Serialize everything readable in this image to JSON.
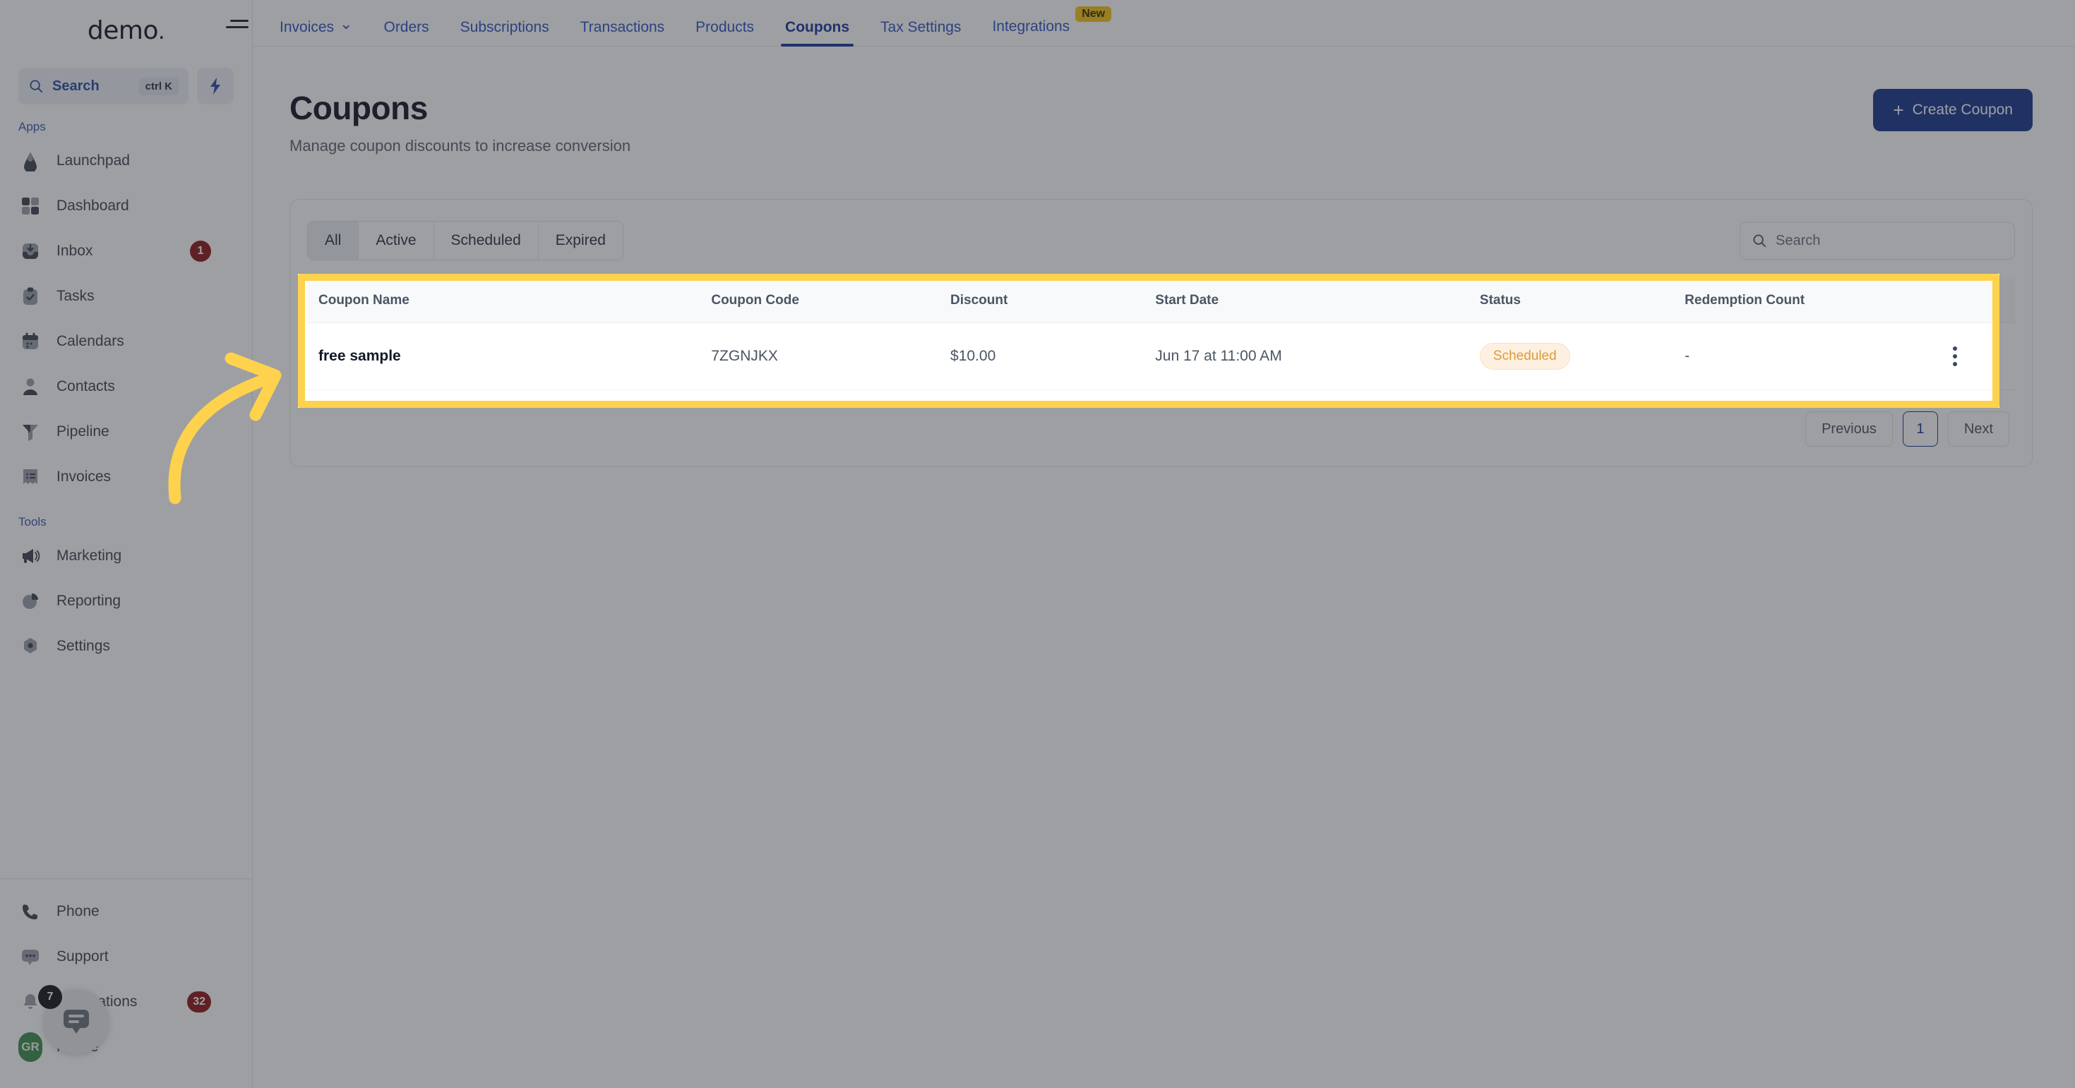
{
  "sidebar": {
    "brand": "demo",
    "brand_dot": ".",
    "search": {
      "label": "Search",
      "shortcut": "ctrl K"
    },
    "sections": [
      {
        "label": "Apps",
        "items": [
          {
            "label": "Launchpad",
            "icon": "launchpad-icon",
            "badge": ""
          },
          {
            "label": "Dashboard",
            "icon": "dashboard-icon",
            "badge": ""
          },
          {
            "label": "Inbox",
            "icon": "inbox-icon",
            "badge": "1"
          },
          {
            "label": "Tasks",
            "icon": "tasks-icon",
            "badge": ""
          },
          {
            "label": "Calendars",
            "icon": "calendar-icon",
            "badge": ""
          },
          {
            "label": "Contacts",
            "icon": "contacts-icon",
            "badge": ""
          },
          {
            "label": "Pipeline",
            "icon": "pipeline-icon",
            "badge": ""
          },
          {
            "label": "Invoices",
            "icon": "invoices-icon",
            "badge": ""
          }
        ]
      },
      {
        "label": "Tools",
        "items": [
          {
            "label": "Marketing",
            "icon": "megaphone-icon",
            "badge": ""
          },
          {
            "label": "Reporting",
            "icon": "pie-chart-icon",
            "badge": ""
          },
          {
            "label": "Settings",
            "icon": "gear-icon",
            "badge": ""
          }
        ]
      }
    ],
    "bottom_items": [
      {
        "label": "Phone",
        "icon": "phone-icon",
        "badge": ""
      },
      {
        "label": "Support",
        "icon": "support-chat-icon",
        "badge": ""
      },
      {
        "label": "Notifications",
        "icon": "bell-icon",
        "badge": "32"
      },
      {
        "label": "Profile",
        "icon": "avatar",
        "badge": "",
        "avatar_initials": "GR"
      }
    ],
    "chat_widget_badge": "7"
  },
  "topnav": {
    "tabs": [
      {
        "label": "Invoices",
        "active": false,
        "caret": "⌄",
        "badge": ""
      },
      {
        "label": "Orders",
        "active": false,
        "caret": "",
        "badge": ""
      },
      {
        "label": "Subscriptions",
        "active": false,
        "caret": "",
        "badge": ""
      },
      {
        "label": "Transactions",
        "active": false,
        "caret": "",
        "badge": ""
      },
      {
        "label": "Products",
        "active": false,
        "caret": "",
        "badge": ""
      },
      {
        "label": "Coupons",
        "active": true,
        "caret": "",
        "badge": ""
      },
      {
        "label": "Tax Settings",
        "active": false,
        "caret": "",
        "badge": ""
      },
      {
        "label": "Integrations",
        "active": false,
        "caret": "",
        "badge": "New"
      }
    ]
  },
  "page": {
    "title": "Coupons",
    "subtitle": "Manage coupon discounts to increase conversion",
    "create_button": "Create Coupon",
    "create_button_icon": "+"
  },
  "filters": {
    "tabs": [
      "All",
      "Active",
      "Scheduled",
      "Expired"
    ],
    "active_index": 0,
    "search_placeholder": "Search"
  },
  "table": {
    "columns": [
      "Coupon Name",
      "Coupon Code",
      "Discount",
      "Start Date",
      "Status",
      "Redemption Count",
      ""
    ],
    "rows": [
      {
        "name": "free sample",
        "code": "7ZGNJKX",
        "discount": "$10.00",
        "start_date": "Jun 17 at 11:00 AM",
        "status": "Scheduled",
        "redemption_count": "-",
        "menu": "kebab-menu-icon"
      }
    ]
  },
  "pagination": {
    "previous": "Previous",
    "current_page": "1",
    "next": "Next"
  },
  "colors": {
    "accent_blue": "#1b3a8f",
    "highlight_yellow": "#ffd24d",
    "status_orange": "#de9b37",
    "badge_red": "#8d1a1a"
  }
}
